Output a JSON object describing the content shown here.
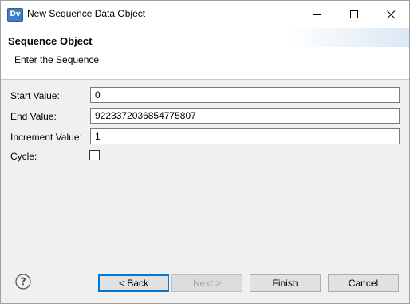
{
  "window": {
    "app_icon_text": "Dv",
    "title": "New Sequence Data Object"
  },
  "banner": {
    "title": "Sequence Object",
    "message": "Enter the Sequence"
  },
  "form": {
    "start_label": "Start Value:",
    "start_value": "0",
    "end_label": "End Value:",
    "end_value": "9223372036854775807",
    "increment_label": "Increment Value:",
    "increment_value": "1",
    "cycle_label": "Cycle:",
    "cycle_checked": false
  },
  "buttons": {
    "back": "< Back",
    "next": "Next >",
    "finish": "Finish",
    "cancel": "Cancel"
  },
  "icons": {
    "app": "dv-app-icon",
    "minimize": "minimize-icon",
    "maximize": "maximize-icon",
    "close": "close-icon",
    "help": "help-icon"
  },
  "colors": {
    "default_button_border": "#0078d7",
    "app_icon": "#3d7fc1"
  }
}
